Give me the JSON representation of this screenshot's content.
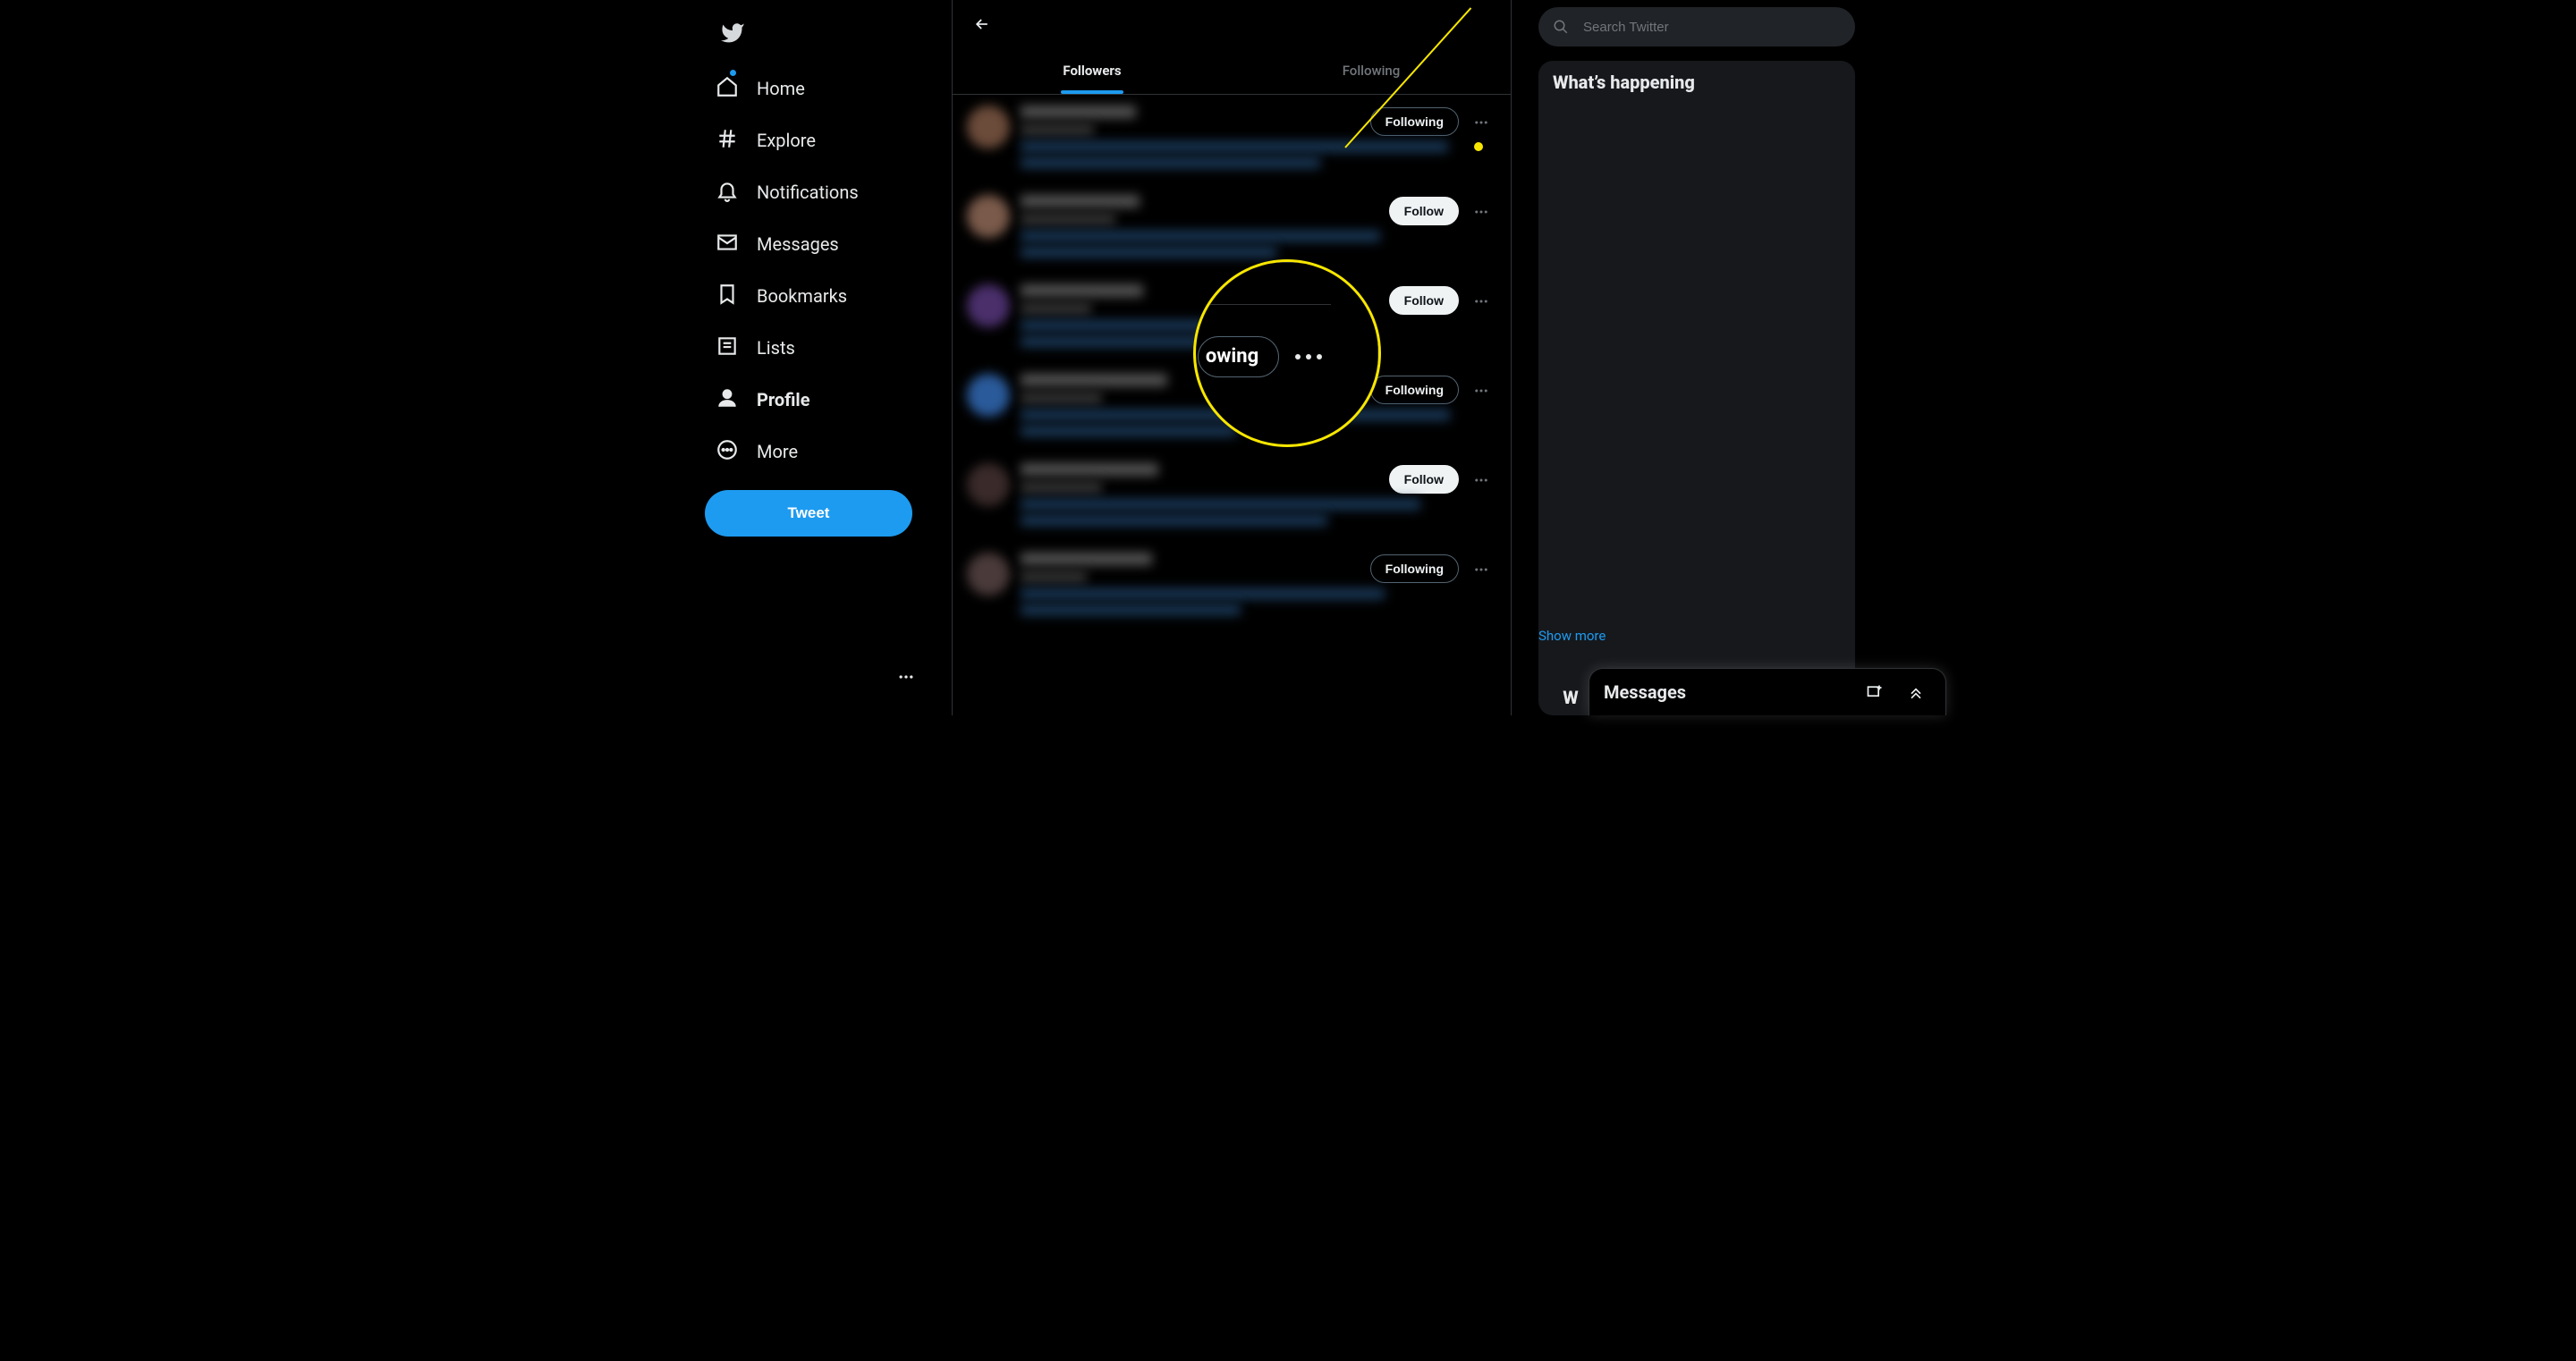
{
  "sidebar": {
    "items": [
      {
        "label": "Home"
      },
      {
        "label": "Explore"
      },
      {
        "label": "Notifications"
      },
      {
        "label": "Messages"
      },
      {
        "label": "Bookmarks"
      },
      {
        "label": "Lists"
      },
      {
        "label": "Profile"
      },
      {
        "label": "More"
      }
    ],
    "tweet_label": "Tweet"
  },
  "tabs": {
    "followers": "Followers",
    "following": "Following"
  },
  "buttons": {
    "following": "Following",
    "follow": "Follow"
  },
  "users": [
    {
      "state": "following",
      "avatar": "#6b4b3a"
    },
    {
      "state": "follow",
      "avatar": "#7a5a4a"
    },
    {
      "state": "follow",
      "avatar": "#4a2f6b"
    },
    {
      "state": "following",
      "avatar": "#2a5a9a"
    },
    {
      "state": "follow",
      "avatar": "#3a2a2a"
    },
    {
      "state": "following",
      "avatar": "#4a3a3a"
    }
  ],
  "search": {
    "placeholder": "Search Twitter"
  },
  "trends": {
    "title": "What’s happening",
    "show_more": "Show more"
  },
  "messages": {
    "title": "Messages"
  },
  "magnifier": {
    "pill_text": "owing"
  },
  "peek": "W"
}
